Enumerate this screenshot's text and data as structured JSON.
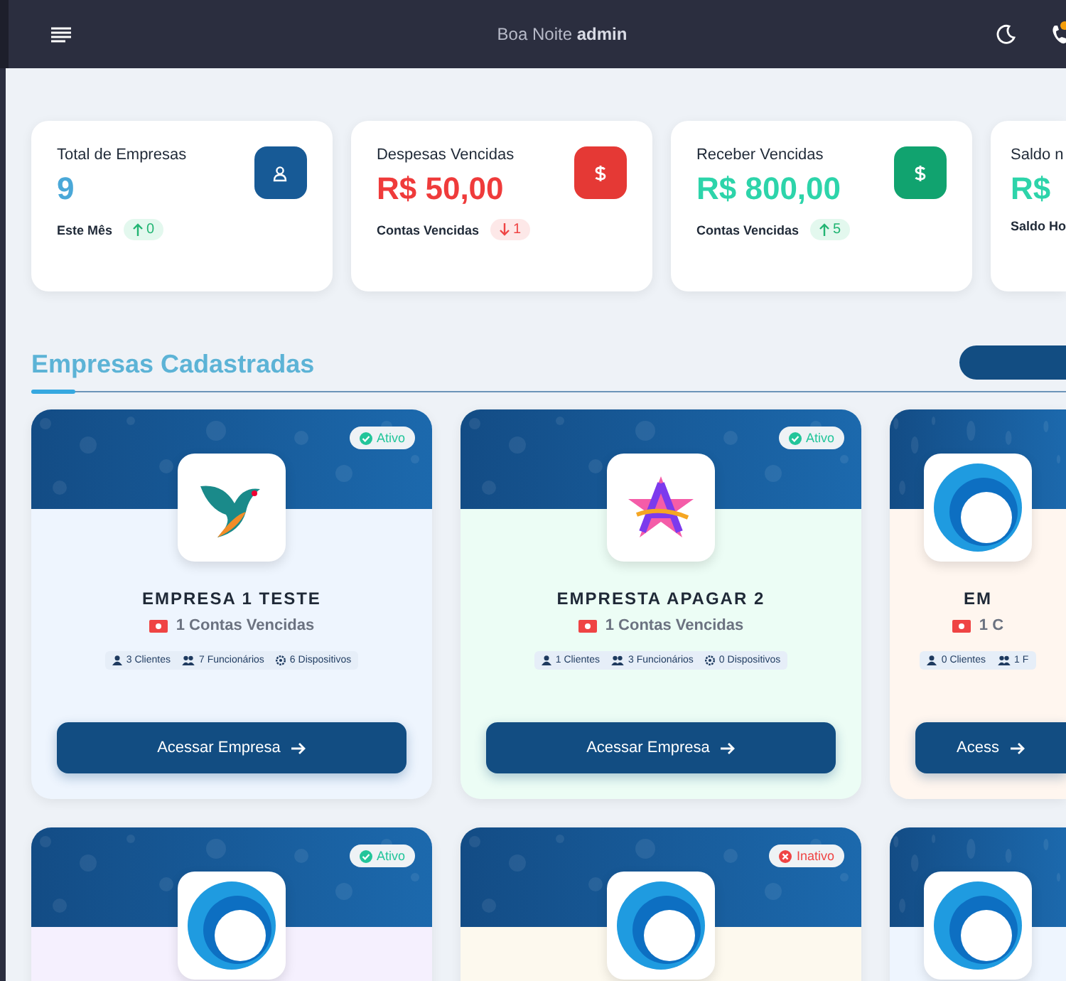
{
  "header": {
    "greeting": "Boa Noite **admin**"
  },
  "stats": [
    {
      "kind": "count",
      "title": "Total de Empresas",
      "value": "9",
      "footer": "Este Mês",
      "trend": {
        "kind": "up",
        "count": "0"
      }
    },
    {
      "kind": "expense",
      "title": "Despesas Vencidas",
      "value": "R$ 50,00",
      "footer": "Contas Vencidas",
      "trend": {
        "kind": "down",
        "count": "1"
      }
    },
    {
      "kind": "income",
      "title": "Receber Vencidas",
      "value": "R$ 800,00",
      "footer": "Contas Vencidas",
      "trend": {
        "kind": "up",
        "count": "5"
      }
    },
    {
      "kind": "balance",
      "title": "Saldo n",
      "value": "R$",
      "footer": "Saldo Ho"
    }
  ],
  "section": {
    "title": "Empresas Cadastradas"
  },
  "companies": [
    {
      "kind": "bird",
      "status": "Ativo",
      "active": true,
      "color": "#eef5fe",
      "name": "EMPRESA 1 TESTE",
      "overdue": "1 Contas Vencidas",
      "facts": [
        {
          "kind": "clients",
          "text": "3 Clientes"
        },
        {
          "kind": "staff",
          "text": "7 Funcionários"
        },
        {
          "kind": "devices",
          "text": "6 Dispositivos"
        }
      ],
      "button": "Acessar Empresa"
    },
    {
      "kind": "star",
      "status": "Ativo",
      "active": true,
      "color": "#ecfdf5",
      "name": "EMPRESTA APAGAR 2",
      "overdue": "1 Contas Vencidas",
      "facts": [
        {
          "kind": "clients",
          "text": "1 Clientes"
        },
        {
          "kind": "staff",
          "text": "3 Funcionários"
        },
        {
          "kind": "devices",
          "text": "0 Dispositivos"
        }
      ],
      "button": "Acessar Empresa"
    },
    {
      "kind": "wave",
      "color": "#fff6ef",
      "name": "EM",
      "overdue": "1 C",
      "facts": [
        {
          "kind": "clients",
          "text": "0 Clientes"
        },
        {
          "kind": "staff",
          "text": "1 F"
        }
      ],
      "button": "Acess"
    },
    {
      "kind": "wave",
      "status": "Ativo",
      "active": true,
      "color": "#f5f0fe"
    },
    {
      "kind": "wave",
      "status": "Inativo",
      "active": false,
      "color": "#fdf9ee"
    },
    {
      "kind": "wave",
      "color": "#eef5fe"
    }
  ]
}
